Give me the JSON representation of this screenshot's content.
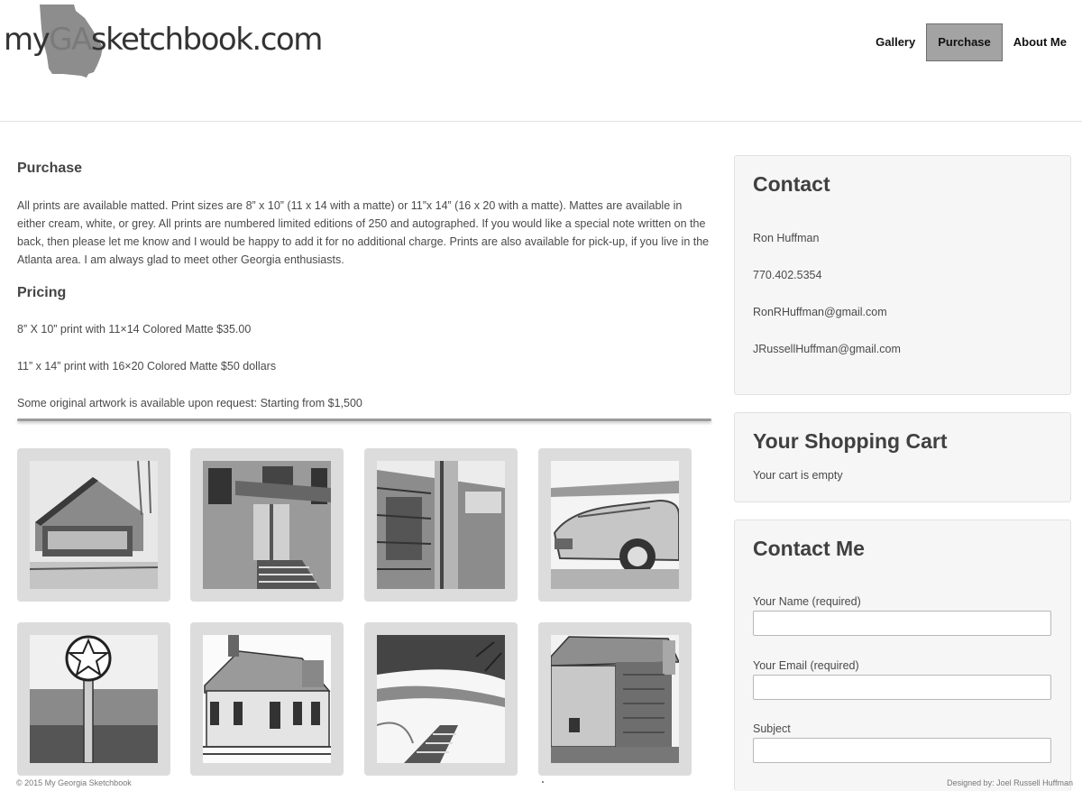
{
  "logo": {
    "prefix": "my",
    "state": "GA",
    "suffix": "sketchbook.com"
  },
  "nav": [
    {
      "label": "Gallery",
      "active": false
    },
    {
      "label": "Purchase",
      "active": true
    },
    {
      "label": "About Me",
      "active": false
    }
  ],
  "main": {
    "purchase_title": "Purchase",
    "purchase_text": "All prints are available matted. Print sizes are 8” x 10” (11 x 14 with a matte) or 11”x 14” (16 x 20 with a matte). Mattes are available in either cream, white, or grey. All prints are numbered limited editions of 250 and autographed. If you would like a special note written on the back, then please let me know and I would be happy to add it for no additional charge. Prints are also available for pick-up, if you live in the Atlanta area. I am always glad to meet other Georgia enthusiasts.",
    "pricing_title": "Pricing",
    "prices": [
      "8” X 10” print with 11×14 Colored Matte $35.00",
      "11” x 14” print with 16×20 Colored Matte $50 dollars",
      "Some original artwork is available upon request: Starting from $1,500"
    ],
    "gallery": [
      {
        "icon": "covered-bridge-sketch"
      },
      {
        "icon": "old-building-stairs-sketch"
      },
      {
        "icon": "old-store-sketch"
      },
      {
        "icon": "classic-car-sketch"
      },
      {
        "icon": "star-sign-sketch"
      },
      {
        "icon": "farmhouse-sketch"
      },
      {
        "icon": "boardwalk-creek-sketch"
      },
      {
        "icon": "stone-barn-sketch"
      }
    ]
  },
  "sidebar": {
    "contact": {
      "title": "Contact",
      "name": "Ron Huffman",
      "phone": "770.402.5354",
      "email1": "RonRHuffman@gmail.com",
      "email2": "JRussellHuffman@gmail.com"
    },
    "cart": {
      "title": "Your Shopping Cart",
      "status": "Your cart is empty"
    },
    "contact_form": {
      "title": "Contact Me",
      "name_label": "Your Name (required)",
      "email_label": "Your Email (required)",
      "subject_label": "Subject"
    }
  },
  "footer": {
    "copyright": "© 2015 My Georgia Sketchbook",
    "credit": "Designed by: Joel Russell Huffman"
  },
  "colors": {
    "nav_active_bg": "#a3a3a3",
    "thumb_bg": "#dcdcdc",
    "box_bg": "#f6f6f6"
  }
}
